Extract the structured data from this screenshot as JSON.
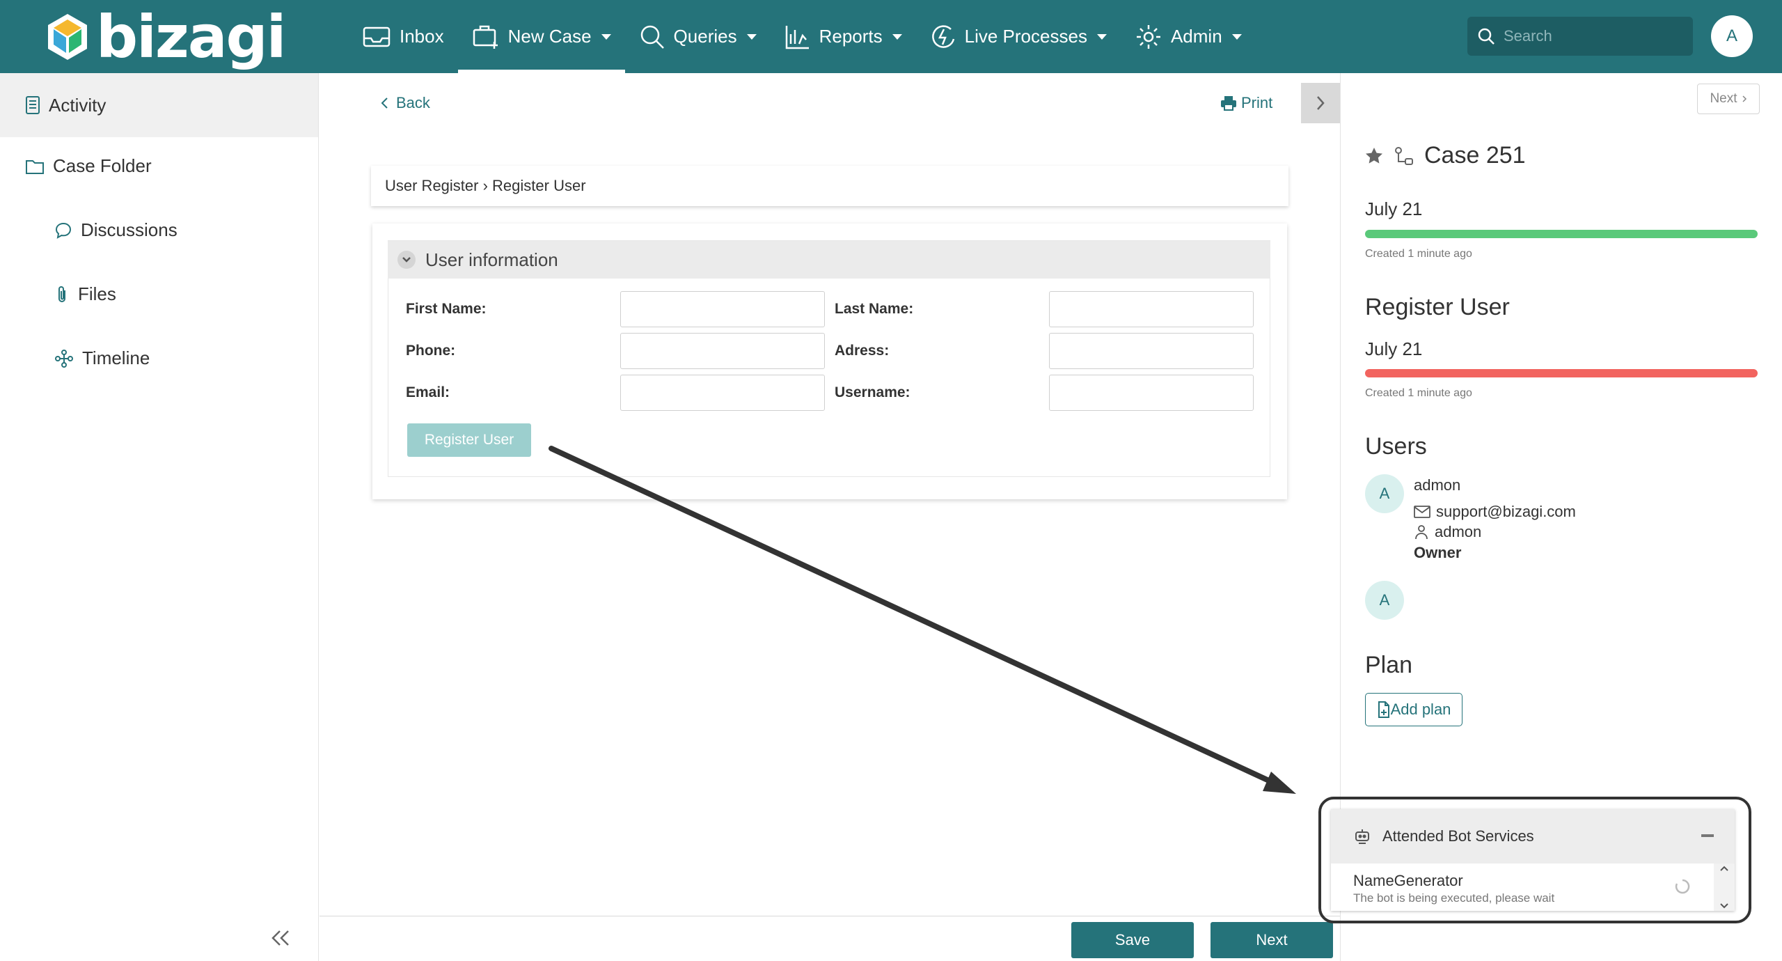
{
  "app": {
    "logo_text": "bizagi"
  },
  "nav": {
    "items": [
      {
        "label": "Inbox"
      },
      {
        "label": "New Case"
      },
      {
        "label": "Queries"
      },
      {
        "label": "Reports"
      },
      {
        "label": "Live Processes"
      },
      {
        "label": "Admin"
      }
    ],
    "search_placeholder": "Search",
    "avatar_initial": "A"
  },
  "sidebar": {
    "activity": "Activity",
    "case_folder": "Case Folder",
    "discussions": "Discussions",
    "files": "Files",
    "timeline": "Timeline"
  },
  "main": {
    "back": "Back",
    "print": "Print",
    "breadcrumb": "User Register › Register User",
    "group_title": "User information",
    "fields": {
      "first_name": "First Name:",
      "last_name": "Last Name:",
      "phone": "Phone:",
      "address": "Adress:",
      "email": "Email:",
      "username": "Username:"
    },
    "register_button": "Register User",
    "save": "Save",
    "next": "Next"
  },
  "right_panel": {
    "next": "Next",
    "case_title": "Case 251",
    "case_date": "July 21",
    "case_created": "Created 1 minute ago",
    "task_title": "Register User",
    "task_date": "July 21",
    "task_created": "Created 1 minute ago",
    "users_title": "Users",
    "user": {
      "avatar": "A",
      "name": "admon",
      "email": "support@bizagi.com",
      "username": "admon",
      "role": "Owner"
    },
    "second_avatar": "A",
    "plan_title": "Plan",
    "add_plan": "Add plan"
  },
  "bot": {
    "title": "Attended Bot Services",
    "name": "NameGenerator",
    "status": "The bot is being executed, please wait"
  },
  "colors": {
    "brand": "#25737a",
    "case_bar": "#5ac97a",
    "task_bar": "#f2645f"
  }
}
